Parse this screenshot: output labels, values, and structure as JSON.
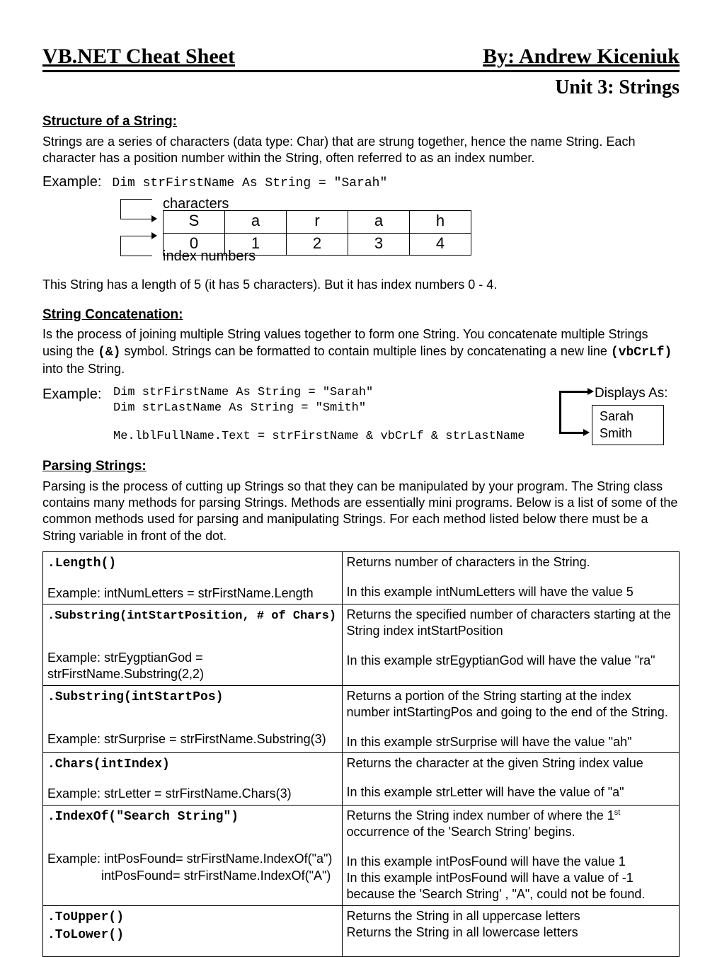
{
  "header": {
    "title_left": "VB.NET Cheat Sheet",
    "title_right": "By:  Andrew Kiceniuk",
    "unit": "Unit 3: Strings"
  },
  "structure": {
    "heading": "Structure of a String:",
    "intro": "Strings are a series of characters (data type: Char) that are strung together, hence the name String. Each character has a position number within the String, often referred to as an index number.",
    "example_label": "Example:",
    "example_code": "Dim strFirstName As String = \"Sarah\"",
    "characters_label": "characters",
    "index_label": "index numbers",
    "chars": [
      "S",
      "a",
      "r",
      "a",
      "h"
    ],
    "indices": [
      "0",
      "1",
      "2",
      "3",
      "4"
    ],
    "length_note": "This String has a length of 5 (it has 5 characters). But it has index numbers 0 - 4."
  },
  "concat": {
    "heading": "String Concatenation:",
    "intro_a": "Is the process of joining multiple String values together to form one String. You concatenate multiple Strings using the ",
    "amp_symbol": "(&)",
    "intro_b": " symbol. Strings can be formatted to contain multiple lines by concatenating a new line ",
    "crlf_symbol": "(vbCrLf)",
    "intro_c": " into the String.",
    "example_label": "Example:",
    "code_line1": "Dim strFirstName As String = \"Sarah\"",
    "code_line2": "Dim strLastName As String  = \"Smith\"",
    "code_line3": "Me.lblFullName.Text = strFirstName & vbCrLf & strLastName",
    "displays_label": "Displays As:",
    "displays_line1": "Sarah",
    "displays_line2": "Smith"
  },
  "parsing": {
    "heading": "Parsing Strings:",
    "intro": "Parsing is the process of cutting up Strings so that they can be manipulated by your program. The String class contains many methods for parsing Strings. Methods are essentially mini programs. Below is a list of some of the common methods used for parsing and manipulating  Strings. For each method listed below there must be a  String variable in front of the dot."
  },
  "methods": {
    "row1": {
      "sig": ".Length()",
      "example": "Example: intNumLetters = strFirstName.Length",
      "desc": "Returns number of  characters in the String.",
      "result": "In this example intNumLetters will have the value 5"
    },
    "row2": {
      "sig": ".Substring(intStartPosition, # of Chars)",
      "example": "Example: strEygptianGod = strFirstName.Substring(2,2)",
      "desc": "Returns the specified number of characters starting at the String index intStartPosition",
      "result": "In this example strEgyptianGod will have the value \"ra\""
    },
    "row3": {
      "sig": ".Substring(intStartPos)",
      "example": "Example: strSurprise = strFirstName.Substring(3)",
      "desc": "Returns a portion of the String starting at the index number intStartingPos and going to the end of the String.",
      "result": "In this example strSurprise will have the value \"ah\""
    },
    "row4": {
      "sig": ".Chars(intIndex)",
      "example": "Example: strLetter = strFirstName.Chars(3)",
      "desc": "Returns the character at the given String index value",
      "result": "In this example strLetter will have the value of \"a\""
    },
    "row5": {
      "sig": ".IndexOf(\"Search String\")",
      "example1": "Example: intPosFound= strFirstName.IndexOf(\"a\")",
      "example2": "intPosFound= strFirstName.IndexOf(\"A\")",
      "desc_a": "Returns the String index number of where the 1",
      "desc_sup": "st",
      "desc_b": " occurrence of the 'Search String' begins.",
      "result1": "In this example intPosFound will have the value 1",
      "result2": "In this example intPosFound will have a value of -1 because the 'Search String' , \"A\", could not be found."
    },
    "row6": {
      "sig1": ".ToUpper()",
      "sig2": ".ToLower()",
      "desc1": "Returns the String in all uppercase letters",
      "desc2": "Returns the String in all lowercase letters"
    }
  }
}
